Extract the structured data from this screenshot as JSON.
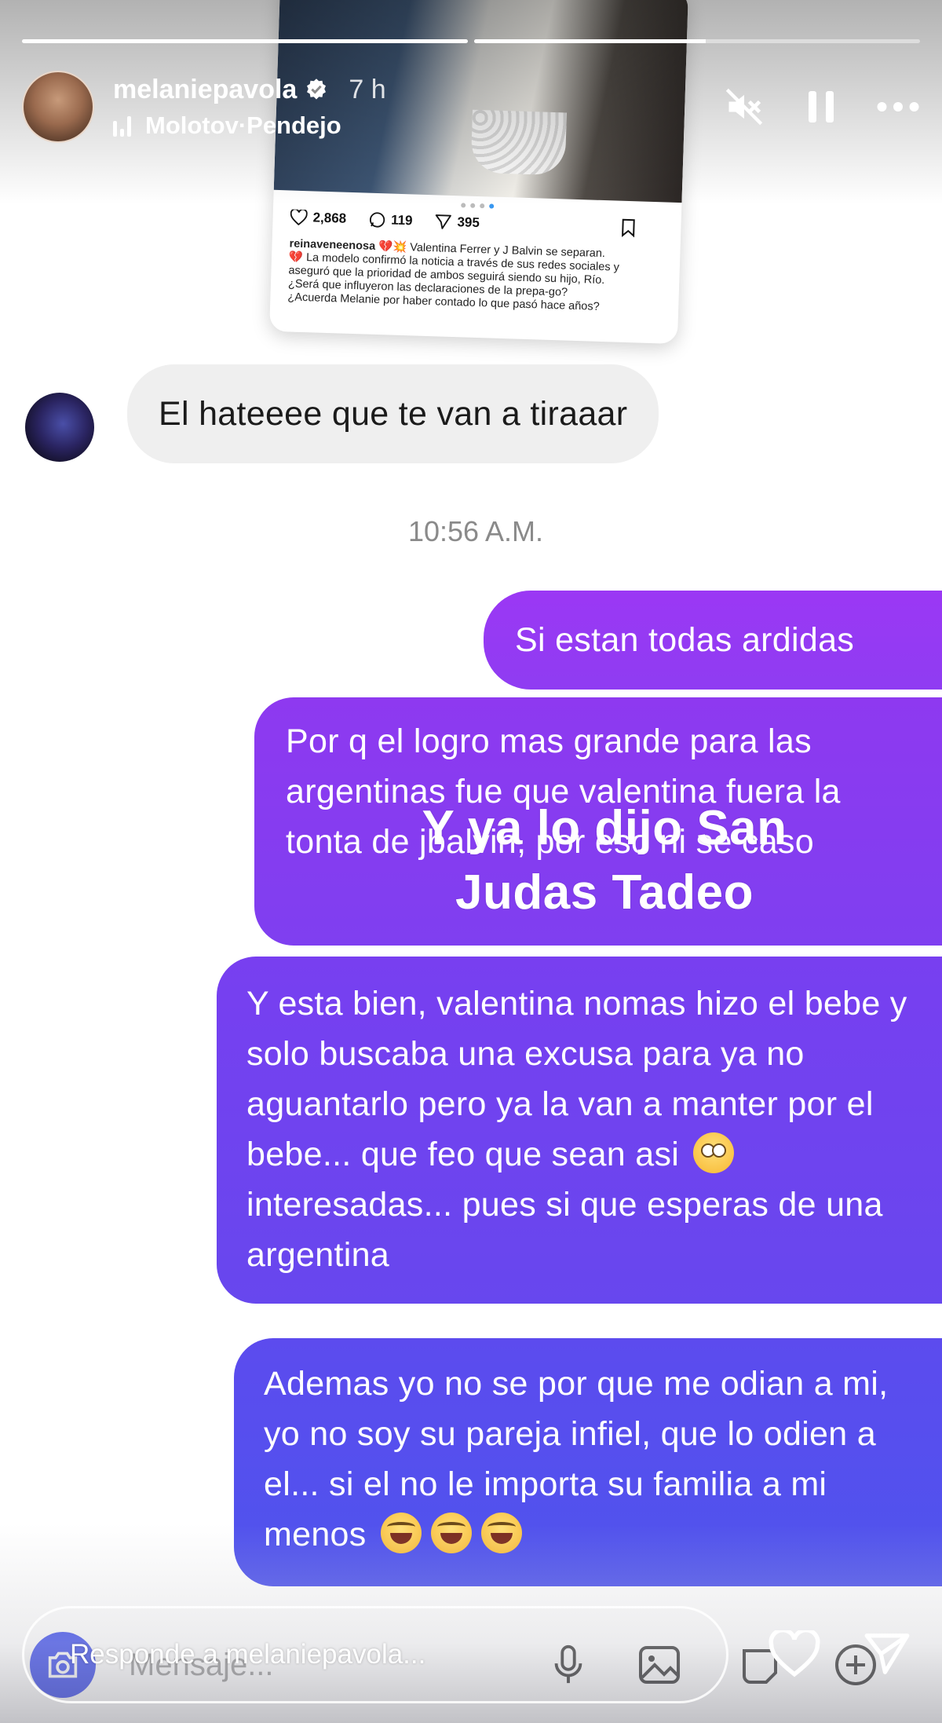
{
  "story": {
    "progress": [
      1.0,
      0.52
    ],
    "username": "melaniepavola",
    "time_ago": "7 h",
    "music_artist": "Molotov",
    "music_separator": " · ",
    "music_song": "Pendejo"
  },
  "post": {
    "likes": "2,868",
    "comments": "119",
    "shares": "395",
    "caption_user": "reinaveneenosa",
    "caption_line1": " 💔💥 Valentina Ferrer y J Balvin se separan.",
    "caption_line2": "💔 La modelo confirmó la noticia a través de sus redes sociales y aseguró que la prioridad de ambos seguirá siendo su hijo, Río.",
    "caption_line3": "¿Será que influyeron las declaraciones de la prepa-go?",
    "caption_line4": "¿Acuerda Melanie por haber contado lo que pasó hace años?"
  },
  "conversation": {
    "incoming_message": "El hateeee que te van a tiraaar",
    "timestamp": "10:56 A.M.",
    "outgoing": {
      "m1": "Si estan todas ardidas",
      "m2": "Por q el logro mas grande para las argentinas fue que valentina fuera la tonta de jbalvin, por eso ni se caso",
      "m3_part1": "Y esta bien, valentina nomas hizo el bebe y solo buscaba una excusa para ya no aguantarlo pero ya la van a manter por el bebe... que feo que sean asi",
      "m3_emoji": "face-with-rolling-eyes",
      "m3_part2": " interesadas... pues si que esperas de una argentina",
      "m4_text": "Ademas yo no se por que me odian a mi, yo no soy su pareja infiel, que lo odien a el... si el no le importa su familia a mi menos",
      "m4_emojis": [
        "rolling-on-floor-laughing",
        "rolling-on-floor-laughing",
        "rolling-on-floor-laughing"
      ]
    }
  },
  "overlay": {
    "line1": "Y ya lo dijo San",
    "line2": "Judas Tadeo"
  },
  "composer": {
    "placeholder": "Mensaje..."
  },
  "reply": {
    "placeholder": "Responde a melaniepavola..."
  },
  "icons": {
    "mute": "speaker-muted-icon",
    "pause": "pause-icon",
    "more": "more-horizontal-icon",
    "heart": "heart-icon",
    "send": "send-icon",
    "camera": "camera-icon",
    "mic": "microphone-icon",
    "gallery": "image-icon",
    "sticker": "sticker-icon",
    "add": "plus-icon"
  },
  "colors": {
    "bubble_start": "#9b38f4",
    "bubble_end": "#4e54ed",
    "incoming_bubble": "#efefef",
    "verified": "#ffffff"
  }
}
